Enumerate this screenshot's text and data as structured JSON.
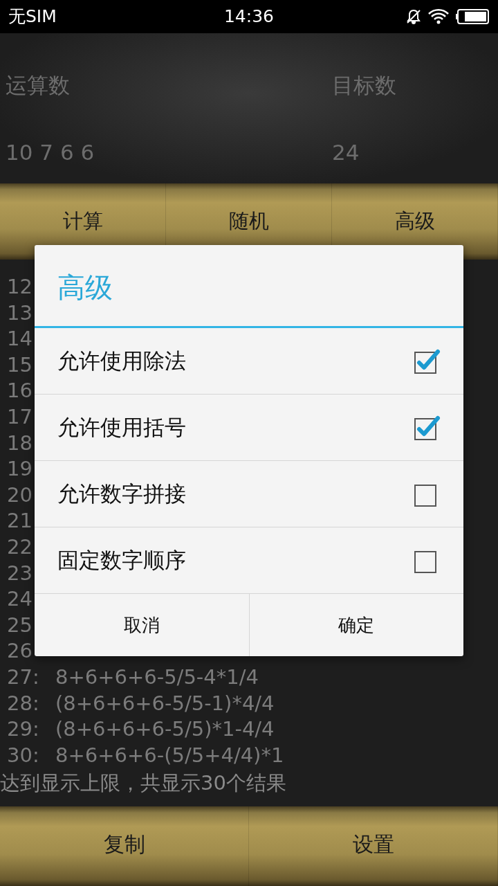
{
  "status_bar": {
    "carrier": "无SIM",
    "time": "14:36"
  },
  "inputs": [
    {
      "label": "运算数",
      "value": "10 7 6 6"
    },
    {
      "label": "目标数",
      "value": "24"
    }
  ],
  "actions": [
    "计算",
    "随机",
    "高级"
  ],
  "results": [
    {
      "index": "12"
    },
    {
      "index": "13"
    },
    {
      "index": "14"
    },
    {
      "index": "15"
    },
    {
      "index": "16"
    },
    {
      "index": "17"
    },
    {
      "index": "18"
    },
    {
      "index": "19"
    },
    {
      "index": "20"
    },
    {
      "index": "21"
    },
    {
      "index": "22"
    },
    {
      "index": "23"
    },
    {
      "index": "24"
    },
    {
      "index": "25"
    },
    {
      "index": "26"
    },
    {
      "index": "27:",
      "expression": "8+6+6+6-5/5-4*1/4"
    },
    {
      "index": "28:",
      "expression": "(8+6+6+6-5/5-1)*4/4"
    },
    {
      "index": "29:",
      "expression": "(8+6+6+6-5/5)*1-4/4"
    },
    {
      "index": "30:",
      "expression": "8+6+6+6-(5/5+4/4)*1"
    }
  ],
  "summary": "达到显示上限，共显示30个结果",
  "bottom_buttons": [
    "复制",
    "设置"
  ],
  "dialog": {
    "title": "高级",
    "options": [
      {
        "label": "允许使用除法",
        "checked": true
      },
      {
        "label": "允许使用括号",
        "checked": true
      },
      {
        "label": "允许数字拼接",
        "checked": false
      },
      {
        "label": "固定数字顺序",
        "checked": false
      }
    ],
    "buttons": [
      "取消",
      "确定"
    ]
  }
}
